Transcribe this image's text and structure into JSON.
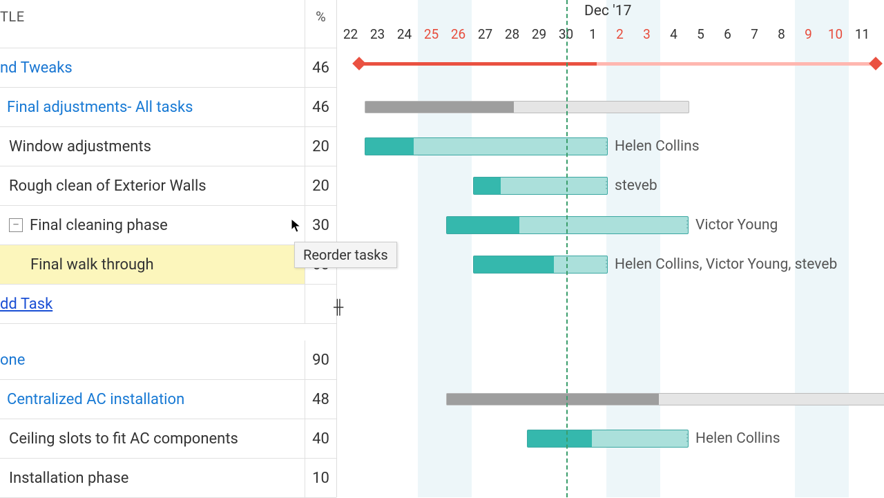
{
  "header": {
    "title_col": "TLE",
    "pct_col": "%"
  },
  "month_label": "Dec '17",
  "tooltip": "Reorder tasks",
  "add_task": "dd Task",
  "days": [
    {
      "n": "22",
      "wk": false
    },
    {
      "n": "23",
      "wk": false
    },
    {
      "n": "24",
      "wk": false
    },
    {
      "n": "25",
      "wk": true
    },
    {
      "n": "26",
      "wk": true
    },
    {
      "n": "27",
      "wk": false
    },
    {
      "n": "28",
      "wk": false
    },
    {
      "n": "29",
      "wk": false
    },
    {
      "n": "30",
      "wk": false
    },
    {
      "n": "1",
      "wk": false
    },
    {
      "n": "2",
      "wk": true
    },
    {
      "n": "3",
      "wk": true
    },
    {
      "n": "4",
      "wk": false
    },
    {
      "n": "5",
      "wk": false
    },
    {
      "n": "6",
      "wk": false
    },
    {
      "n": "7",
      "wk": false
    },
    {
      "n": "8",
      "wk": false
    },
    {
      "n": "9",
      "wk": true
    },
    {
      "n": "10",
      "wk": true
    },
    {
      "n": "11",
      "wk": false
    }
  ],
  "rows": [
    {
      "id": "r0",
      "title": "nd Tweaks",
      "pct": "46",
      "style": "section1",
      "indent": 0
    },
    {
      "id": "r1",
      "title": "Final adjustments- All tasks",
      "pct": "46",
      "style": "link1",
      "indent": 1
    },
    {
      "id": "r2",
      "title": "Window adjustments",
      "pct": "20",
      "style": "normal",
      "indent": 2
    },
    {
      "id": "r3",
      "title": "Rough clean of Exterior Walls",
      "pct": "20",
      "style": "normal",
      "indent": 2
    },
    {
      "id": "r4",
      "title": "Final cleaning phase",
      "pct": "30",
      "style": "normal",
      "indent": 2,
      "expand": "-"
    },
    {
      "id": "r5",
      "title": "Final walk through",
      "pct": "60",
      "style": "normal",
      "indent": 3,
      "hl": true
    },
    {
      "id": "addtask"
    },
    {
      "id": "gap"
    },
    {
      "id": "r6",
      "title": "one",
      "pct": "90",
      "style": "section1",
      "indent": 0
    },
    {
      "id": "r7",
      "title": "Centralized AC installation",
      "pct": "48",
      "style": "link1",
      "indent": 1
    },
    {
      "id": "r8",
      "title": "Ceiling slots to fit AC components",
      "pct": "40",
      "style": "normal",
      "indent": 2
    },
    {
      "id": "r9",
      "title": "Installation phase",
      "pct": "10",
      "style": "normal",
      "indent": 2
    }
  ],
  "bars": {
    "r0": {
      "type": "milestone",
      "start": 32,
      "end": 780,
      "prog": 0.46
    },
    "r1": {
      "type": "summary",
      "start": 40,
      "end": 510,
      "prog": 0.46
    },
    "r2": {
      "type": "task",
      "start": 40,
      "end": 392,
      "prog": 0.2,
      "assignee": "Helen Collins"
    },
    "r3": {
      "type": "task",
      "start": 197,
      "end": 392,
      "prog": 0.2,
      "assignee": "steveb"
    },
    "r4": {
      "type": "task",
      "start": 158,
      "end": 509,
      "prog": 0.3,
      "assignee": "Victor Young"
    },
    "r5": {
      "type": "task",
      "start": 197,
      "end": 392,
      "prog": 0.6,
      "assignee": "Helen Collins, Victor Young, steveb"
    },
    "r7": {
      "type": "summary",
      "start": 158,
      "end": 800,
      "prog": 0.48
    },
    "r8": {
      "type": "task",
      "start": 275,
      "end": 509,
      "prog": 0.4,
      "assignee": "Helen Collins"
    }
  },
  "chart_data": {
    "type": "gantt",
    "time_axis": {
      "start": "2017-11-22",
      "end": "2017-12-11",
      "today": "2017-11-30",
      "weekend_days": [
        "2017-11-25",
        "2017-11-26",
        "2017-12-02",
        "2017-12-03",
        "2017-12-09",
        "2017-12-10"
      ]
    },
    "tasks": [
      {
        "name": "nd Tweaks",
        "type": "milestone_span",
        "percent": 46,
        "start": "2017-11-22",
        "end": "2017-12-11"
      },
      {
        "name": "Final adjustments- All tasks",
        "type": "summary",
        "percent": 46,
        "start": "2017-11-23",
        "end": "2017-12-04"
      },
      {
        "name": "Window adjustments",
        "type": "task",
        "percent": 20,
        "start": "2017-11-23",
        "end": "2017-12-01",
        "assignees": [
          "Helen Collins"
        ]
      },
      {
        "name": "Rough clean of Exterior Walls",
        "type": "task",
        "percent": 20,
        "start": "2017-11-27",
        "end": "2017-12-01",
        "assignees": [
          "steveb"
        ]
      },
      {
        "name": "Final cleaning phase",
        "type": "task",
        "percent": 30,
        "start": "2017-11-26",
        "end": "2017-12-04",
        "assignees": [
          "Victor Young"
        ]
      },
      {
        "name": "Final walk through",
        "type": "task",
        "percent": 60,
        "start": "2017-11-27",
        "end": "2017-12-01",
        "assignees": [
          "Helen Collins",
          "Victor Young",
          "steveb"
        ]
      },
      {
        "name": "one",
        "type": "section",
        "percent": 90
      },
      {
        "name": "Centralized AC installation",
        "type": "summary",
        "percent": 48,
        "start": "2017-11-26",
        "end": "2017-12-11"
      },
      {
        "name": "Ceiling slots to fit AC components",
        "type": "task",
        "percent": 40,
        "start": "2017-11-29",
        "end": "2017-12-04",
        "assignees": [
          "Helen Collins"
        ]
      },
      {
        "name": "Installation phase",
        "type": "task",
        "percent": 10
      }
    ]
  }
}
